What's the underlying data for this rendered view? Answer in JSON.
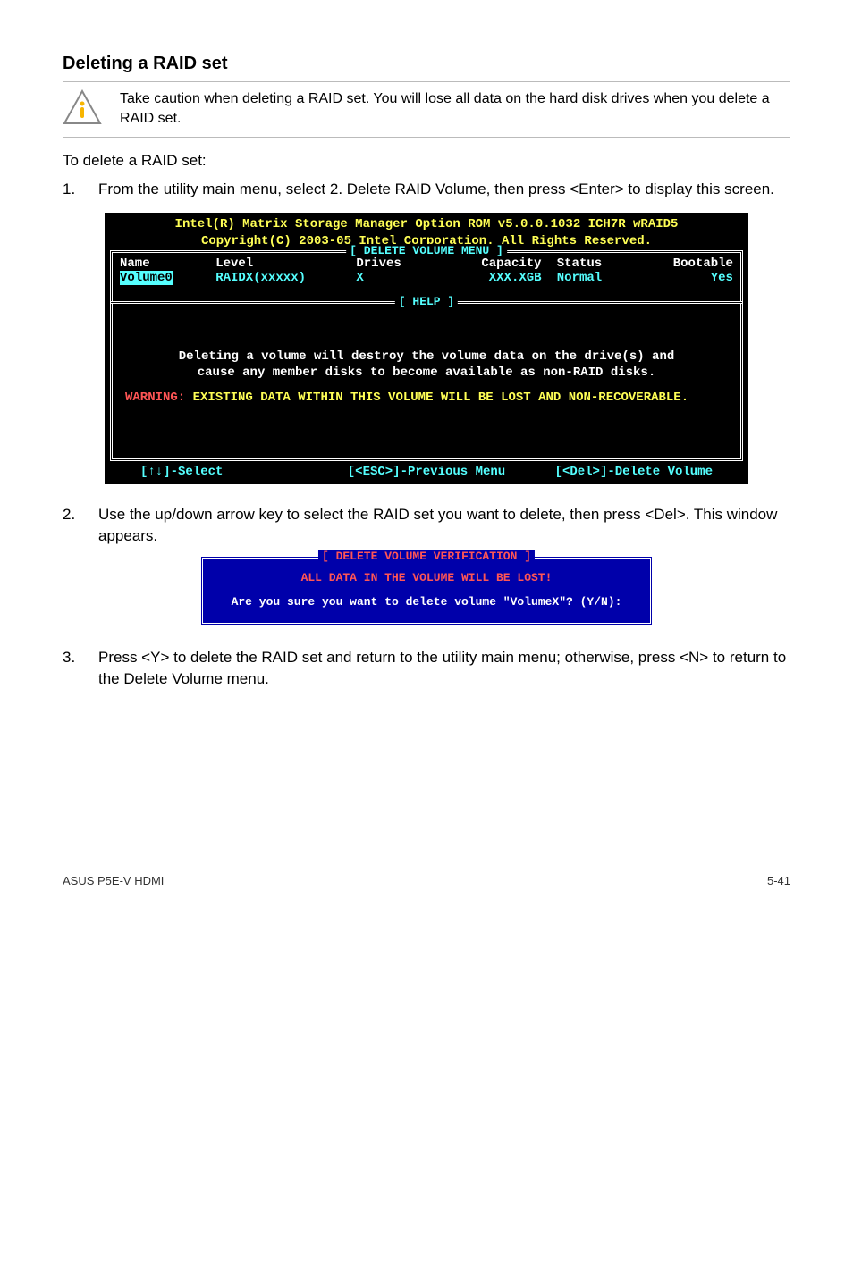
{
  "section_title": "Deleting a RAID set",
  "alert_text": "Take caution when deleting a RAID set. You will lose all data on the hard disk drives when you delete a RAID set.",
  "intro": "To delete a RAID set:",
  "steps": [
    "From the utility main menu, select 2. Delete RAID Volume, then press <Enter> to display this screen.",
    "Use the up/down arrow key to select the RAID set you want to delete, then press <Del>. This window appears.",
    "Press <Y> to delete the RAID set and return to the utility main menu; otherwise, press <N> to return to the Delete Volume menu."
  ],
  "bios": {
    "header1": "Intel(R) Matrix Storage Manager Option ROM v5.0.0.1032 ICH7R wRAID5",
    "header2": "Copyright(C) 2003-05 Intel Corporation. All Rights Reserved.",
    "frame1_title": "[ DELETE VOLUME MENU ]",
    "cols": {
      "c1": "Name",
      "c2": "Level",
      "c3": "Drives",
      "c4": "Capacity",
      "c5": "Status",
      "c6": "Bootable"
    },
    "row": {
      "c1": "Volume0",
      "c2": "RAIDX(xxxxx)",
      "c3": "X",
      "c4": "XXX.XGB",
      "c5": "Normal",
      "c6": "Yes"
    },
    "frame2_title": "[ HELP ]",
    "help_l1": "Deleting a volume will destroy the volume data on the drive(s) and",
    "help_l2": "cause any member disks to become available as non-RAID disks.",
    "warn_label": "WARNING:",
    "warn_text": " EXISTING DATA WITHIN THIS VOLUME WILL BE LOST AND NON-RECOVERABLE.",
    "bottom": {
      "b1": "[↑↓]-Select",
      "b2": "[<ESC>]-Previous Menu",
      "b3": "[<Del>]-Delete Volume"
    }
  },
  "dialog": {
    "title": "[ DELETE VOLUME VERIFICATION ]",
    "lost": "ALL DATA IN THE VOLUME WILL BE LOST!",
    "question": "Are you sure you want to delete volume \"VolumeX\"? (Y/N):"
  },
  "footer_left": "ASUS P5E-V HDMI",
  "footer_right": "5-41"
}
